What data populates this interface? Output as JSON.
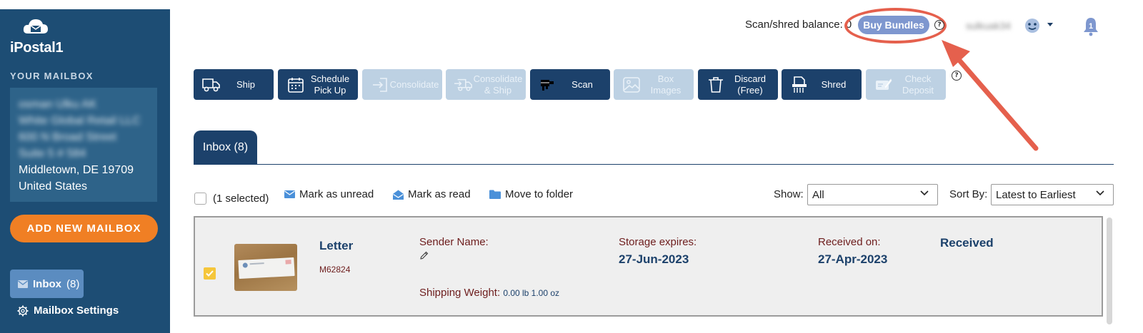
{
  "sidebar": {
    "logo_text": "iPostal1",
    "section_title": "YOUR MAILBOX",
    "address_lines": [
      {
        "text": "osman Ulku AK",
        "blurred": true
      },
      {
        "text": "White Global Retail LLC",
        "blurred": true
      },
      {
        "text": "600 N Broad Street",
        "blurred": true
      },
      {
        "text": "Suite 5 # 584",
        "blurred": true
      },
      {
        "text": "Middletown, DE 19709",
        "blurred": false
      },
      {
        "text": "United States",
        "blurred": false
      }
    ],
    "add_mailbox_label": "ADD NEW MAILBOX",
    "nav_inbox_label": "Inbox",
    "nav_inbox_count": "(8)",
    "nav_settings_label": "Mailbox Settings"
  },
  "header": {
    "balance_label": "Scan/shred balance: 0",
    "buy_bundles_label": "Buy Bundles",
    "help_glyph": "?",
    "user_name": "sulkuak34",
    "bell_count": "1"
  },
  "toolbar": {
    "buttons": [
      {
        "label": "Ship",
        "icon": "truck-icon",
        "enabled": true
      },
      {
        "label": "Schedule\nPick Up",
        "icon": "calendar-icon",
        "enabled": true
      },
      {
        "label": "Consolidate",
        "icon": "sign-in-icon",
        "enabled": false
      },
      {
        "label": "Consolidate\n& Ship",
        "icon": "truck-arrow-icon",
        "enabled": false
      },
      {
        "label": "Scan",
        "icon": "scan-icon",
        "enabled": true
      },
      {
        "label": "Box\nImages",
        "icon": "image-icon",
        "enabled": false
      },
      {
        "label": "Discard\n(Free)",
        "icon": "trash-icon",
        "enabled": true
      },
      {
        "label": "Shred",
        "icon": "shredder-icon",
        "enabled": true
      },
      {
        "label": "Check\nDeposit",
        "icon": "check-deposit-icon",
        "enabled": false
      }
    ]
  },
  "tabs": {
    "inbox_label": "Inbox (8)"
  },
  "actions": {
    "selected_text": "(1 selected)",
    "mark_unread": "Mark as unread",
    "mark_read": "Mark as read",
    "move_folder": "Move to folder",
    "show_label": "Show:",
    "show_value": "All",
    "sort_label": "Sort By:",
    "sort_value": "Latest to Earliest"
  },
  "mail_item": {
    "checked": true,
    "type": "Letter",
    "id": "M62824",
    "sender_label": "Sender Name:",
    "sender_value": "",
    "weight_label": "Shipping Weight:",
    "weight_value": "0.00 lb 1.00 oz",
    "storage_label": "Storage expires:",
    "storage_value": "27-Jun-2023",
    "received_label": "Received on:",
    "received_value": "27-Apr-2023",
    "status": "Received"
  },
  "colors": {
    "sidebar_bg": "#1d4d74",
    "primary_navy": "#1c416b",
    "disabled_btn": "#bdd1e3",
    "orange": "#f07f24",
    "buy_bundles": "#7e97cf",
    "annotation_red": "#e5604d",
    "label_maroon": "#6d1d1d",
    "checkbox_yellow": "#f5c63b"
  }
}
